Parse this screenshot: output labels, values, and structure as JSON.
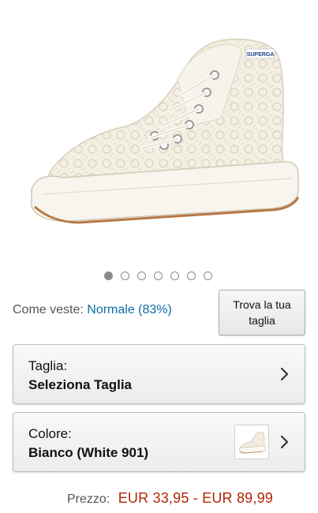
{
  "product": {
    "brand_logo_text": "SUPERGA",
    "image_count": 7,
    "active_image_index": 0
  },
  "fit": {
    "label": "Come veste:",
    "value": "Normale (83%)"
  },
  "find_size_button": {
    "label": "Trova la tua taglia"
  },
  "size_selector": {
    "label": "Taglia:",
    "value": "Seleziona Taglia"
  },
  "color_selector": {
    "label": "Colore:",
    "value": "Bianco (White 901)"
  },
  "price": {
    "label": "Prezzo:",
    "value": "EUR 33,95 - EUR 89,99",
    "color": "#b12704"
  },
  "colors": {
    "link": "#0b6ea8",
    "dot_active": "#8a8a8a"
  }
}
